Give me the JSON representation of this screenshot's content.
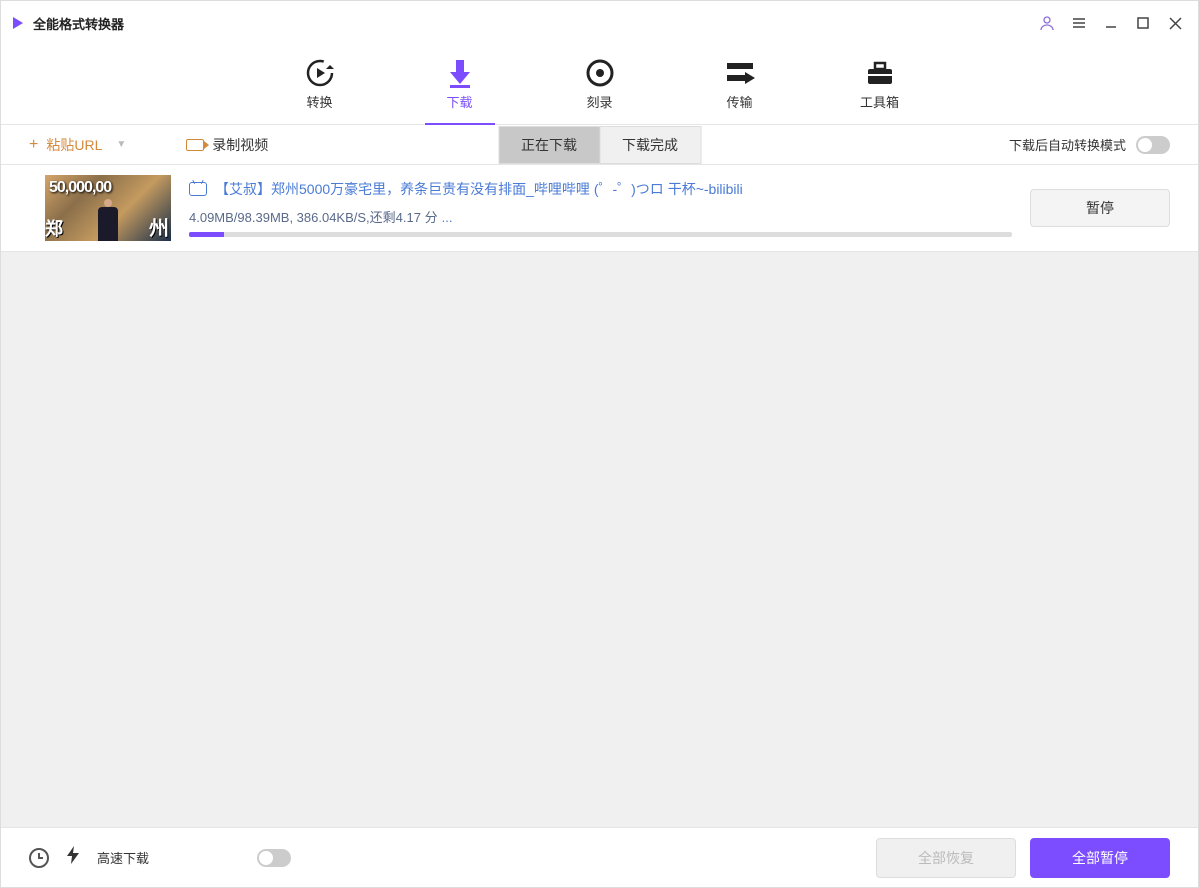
{
  "app": {
    "title": "全能格式转换器"
  },
  "main_tabs": [
    {
      "id": "convert",
      "label": "转换"
    },
    {
      "id": "download",
      "label": "下载"
    },
    {
      "id": "burn",
      "label": "刻录"
    },
    {
      "id": "transfer",
      "label": "传输"
    },
    {
      "id": "toolbox",
      "label": "工具箱"
    }
  ],
  "toolbar": {
    "paste_url": "粘贴URL",
    "record": "录制视频",
    "downloading_tab": "正在下载",
    "completed_tab": "下载完成",
    "auto_convert": "下载后自动转换模式"
  },
  "downloads": [
    {
      "title": "【艾叔】郑州5000万豪宅里，养条巨贵有没有排面_哔哩哔哩 (゜-゜)つロ 干杯~-bilibili",
      "status": "4.09MB/98.39MB, 386.04KB/S,还剩4.17 分",
      "progress_pct": 4.2,
      "pause_label": "暂停"
    }
  ],
  "footer": {
    "fast_download": "高速下载",
    "resume_all": "全部恢复",
    "pause_all": "全部暂停"
  }
}
